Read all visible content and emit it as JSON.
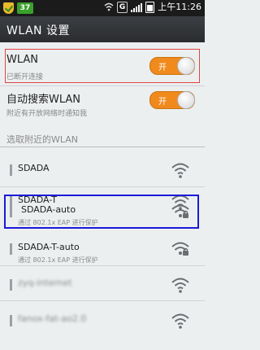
{
  "status_bar": {
    "badge": "37",
    "network": "G",
    "time": "上午11:26",
    "icons": [
      "shield-icon",
      "badge-icon",
      "wifi-signal-icon",
      "network-g-icon",
      "signal-bars-icon",
      "battery-icon"
    ]
  },
  "title": "WLAN 设置",
  "wlan": {
    "label": "WLAN",
    "sub": "已断开连接",
    "toggle": "开"
  },
  "auto_search": {
    "label": "自动搜索WLAN",
    "sub": "附近有开放网络时通知我",
    "toggle": "开"
  },
  "section_header": "选取附近的WLAN",
  "networks": [
    {
      "name": "SDADA",
      "sub": "",
      "secured": false,
      "highlighted": false
    },
    {
      "name": "SDADA-T",
      "sub": "",
      "secured": false,
      "highlighted": false
    },
    {
      "name": "SDADA-auto",
      "sub": "通过 802.1x EAP 进行保护",
      "secured": true,
      "highlighted": true
    },
    {
      "name": "SDADA-T-auto",
      "sub": "通过 802.1x EAP 进行保护",
      "secured": true,
      "highlighted": false
    },
    {
      "name": "zyq-internet",
      "sub": "",
      "secured": false,
      "highlighted": false
    },
    {
      "name": "fanox-fat-ao2.0",
      "sub": "",
      "secured": false,
      "highlighted": false
    }
  ],
  "colors": {
    "toggle_on": "#f08a1c",
    "highlight_box": "#1a1ad8",
    "wlan_box": "#e04545",
    "titlebar": "#2f3236"
  }
}
